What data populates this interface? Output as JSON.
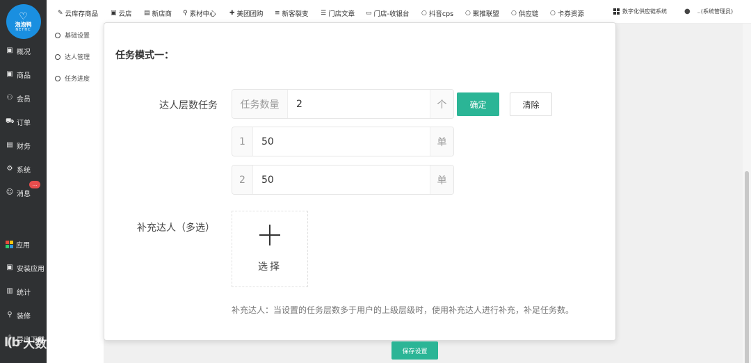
{
  "logo": {
    "mark": "♡",
    "text": "泡泡鸭",
    "sub": "NETHC"
  },
  "sidebar": {
    "items": [
      {
        "label": "概况",
        "icon": "overview-icon",
        "glyph": "▣"
      },
      {
        "label": "商品",
        "icon": "goods-icon",
        "glyph": "▣"
      },
      {
        "label": "会员",
        "icon": "member-icon",
        "glyph": "⚇"
      },
      {
        "label": "订单",
        "icon": "cart-icon",
        "glyph": "⛟"
      },
      {
        "label": "财务",
        "icon": "finance-icon",
        "glyph": "▤"
      },
      {
        "label": "系统",
        "icon": "gear-icon",
        "glyph": "⚙"
      },
      {
        "label": "消息",
        "icon": "message-icon",
        "glyph": "☺"
      },
      {
        "label": "应用",
        "icon": "apps-icon",
        "glyph": ""
      },
      {
        "label": "安装应用",
        "icon": "install-icon",
        "glyph": "▣"
      },
      {
        "label": "统计",
        "icon": "chart-icon",
        "glyph": "▥"
      },
      {
        "label": "装修",
        "icon": "decorate-icon",
        "glyph": "⚲"
      },
      {
        "label": "导出下载",
        "icon": "download-icon",
        "glyph": "⇩"
      }
    ],
    "message_badge": "..."
  },
  "subnav": {
    "items": [
      "基础设置",
      "达人管理",
      "任务进度"
    ]
  },
  "topbar": {
    "items": [
      {
        "label": "云库存商品",
        "glyph": "✎"
      },
      {
        "label": "云店",
        "glyph": "▣"
      },
      {
        "label": "新店商",
        "glyph": "▤"
      },
      {
        "label": "素材中心",
        "glyph": "⚲"
      },
      {
        "label": "美团团购",
        "glyph": "✚"
      },
      {
        "label": "新客裂变",
        "glyph": "≡"
      },
      {
        "label": "门店文章",
        "glyph": "☰"
      },
      {
        "label": "门店-收银台",
        "glyph": "▭"
      },
      {
        "label": "抖音cps",
        "glyph": "○"
      },
      {
        "label": "聚推联盟",
        "glyph": "○"
      },
      {
        "label": "供应链",
        "glyph": "○"
      },
      {
        "label": "卡券资源",
        "glyph": "○"
      }
    ],
    "system_label": "数字化供应链系统",
    "user_label": "..(系统管理员)"
  },
  "modal": {
    "title": "任务模式一：",
    "task_label": "达人层数任务",
    "count_prefix": "任务数量",
    "count_value": "2",
    "count_unit": "个",
    "confirm_label": "确定",
    "clear_label": "清除",
    "levels": [
      {
        "index": "1",
        "value": "50",
        "unit": "单"
      },
      {
        "index": "2",
        "value": "50",
        "unit": "单"
      }
    ],
    "supplement_label": "补充达人（多选）",
    "picker_label": "选择",
    "hint": "补充达人：当设置的任务层数多于用户的上级层级时，使用补充达人进行补充，补足任务数。"
  },
  "save_label": "保存设置",
  "watermark": {
    "logo": "l(b",
    "text": "大数跨境"
  },
  "colors": {
    "accent": "#2bb596",
    "sidebar": "#2f3133",
    "logo": "#1a8fe0",
    "badge": "#e84d4d"
  }
}
